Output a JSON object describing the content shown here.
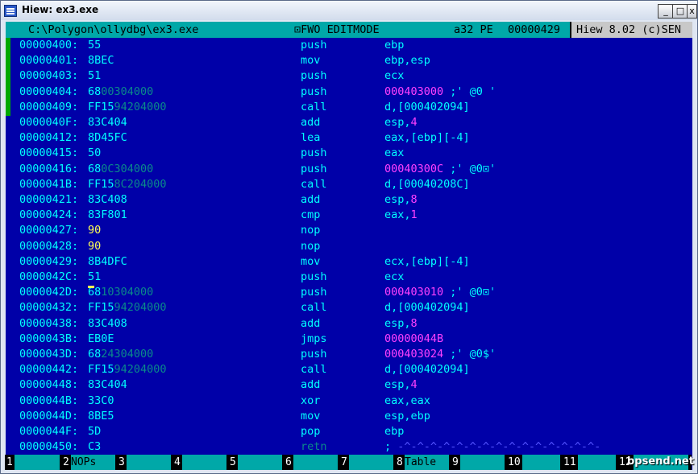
{
  "window": {
    "title": "Hiew: ex3.exe",
    "min_glyph": "_",
    "max_glyph": "□",
    "close_glyph": "x",
    "icon": "app-grid-icon"
  },
  "header": {
    "path": "C:\\Polygon\\ollydbg\\ex3.exe",
    "mode": "⊡FWO EDITMODE",
    "arch": "a32 PE",
    "offset": "00000429",
    "brand": "Hiew 8.02 (c)SEN"
  },
  "colors": {
    "background": "#0000a8",
    "header": "#00a8a8",
    "text": "#00ffff",
    "immediate": "#ff40ff",
    "edited": "#ffff55",
    "fixup": "#0a8a8a"
  },
  "rows": [
    {
      "addr": "00000400:",
      "hex": [
        [
          "55",
          "c"
        ]
      ],
      "mn": "push",
      "op": [
        [
          "ebp",
          "c"
        ]
      ]
    },
    {
      "addr": "00000401:",
      "hex": [
        [
          "8BEC",
          "c"
        ]
      ],
      "mn": "mov",
      "op": [
        [
          "ebp,esp",
          "c"
        ]
      ]
    },
    {
      "addr": "00000403:",
      "hex": [
        [
          "51",
          "c"
        ]
      ],
      "mn": "push",
      "op": [
        [
          "ecx",
          "c"
        ]
      ]
    },
    {
      "addr": "00000404:",
      "hex": [
        [
          "68",
          "c"
        ],
        [
          "00304000",
          "d"
        ]
      ],
      "mn": "push",
      "op": [
        [
          "000403000",
          "m"
        ],
        [
          " ;' @0 '",
          "c"
        ]
      ]
    },
    {
      "addr": "00000409:",
      "hex": [
        [
          "FF15",
          "c"
        ],
        [
          "94204000",
          "d"
        ]
      ],
      "mn": "call",
      "op": [
        [
          "d,[000402094]",
          "c"
        ]
      ]
    },
    {
      "addr": "0000040F:",
      "hex": [
        [
          "83C404",
          "c"
        ]
      ],
      "mn": "add",
      "op": [
        [
          "esp,",
          "c"
        ],
        [
          "4",
          "m"
        ]
      ]
    },
    {
      "addr": "00000412:",
      "hex": [
        [
          "8D45FC",
          "c"
        ]
      ],
      "mn": "lea",
      "op": [
        [
          "eax,[ebp][-4]",
          "c"
        ]
      ]
    },
    {
      "addr": "00000415:",
      "hex": [
        [
          "50",
          "c"
        ]
      ],
      "mn": "push",
      "op": [
        [
          "eax",
          "c"
        ]
      ]
    },
    {
      "addr": "00000416:",
      "hex": [
        [
          "68",
          "c"
        ],
        [
          "0C304000",
          "d"
        ]
      ],
      "mn": "push",
      "op": [
        [
          "00040300C",
          "m"
        ],
        [
          " ;' @0⊡'",
          "c"
        ]
      ]
    },
    {
      "addr": "0000041B:",
      "hex": [
        [
          "FF15",
          "c"
        ],
        [
          "8C204000",
          "d"
        ]
      ],
      "mn": "call",
      "op": [
        [
          "d,[00040208C]",
          "c"
        ]
      ]
    },
    {
      "addr": "00000421:",
      "hex": [
        [
          "83C408",
          "c"
        ]
      ],
      "mn": "add",
      "op": [
        [
          "esp,",
          "c"
        ],
        [
          "8",
          "m"
        ]
      ]
    },
    {
      "addr": "00000424:",
      "hex": [
        [
          "83F801",
          "c"
        ]
      ],
      "mn": "cmp",
      "op": [
        [
          "eax,",
          "c"
        ],
        [
          "1",
          "m"
        ]
      ]
    },
    {
      "addr": "00000427:",
      "hex": [
        [
          "90",
          "y"
        ]
      ],
      "mn": "nop",
      "op": []
    },
    {
      "addr": "00000428:",
      "hex": [
        [
          "90",
          "y"
        ]
      ],
      "mn": "nop",
      "op": []
    },
    {
      "addr": "00000429:",
      "hex": [
        [
          "8B4DFC",
          "c"
        ]
      ],
      "mn": "mov",
      "op": [
        [
          "ecx,[ebp][-4]",
          "c"
        ]
      ]
    },
    {
      "addr": "0000042C:",
      "hex": [
        [
          "51",
          "c"
        ]
      ],
      "mn": "push",
      "op": [
        [
          "ecx",
          "c"
        ]
      ]
    },
    {
      "addr": "0000042D:",
      "hex": [
        [
          "68",
          "c"
        ],
        [
          "10304000",
          "d"
        ]
      ],
      "mn": "push",
      "op": [
        [
          "000403010",
          "m"
        ],
        [
          " ;' @0⊡'",
          "c"
        ]
      ]
    },
    {
      "addr": "00000432:",
      "hex": [
        [
          "FF15",
          "c"
        ],
        [
          "94204000",
          "d"
        ]
      ],
      "mn": "call",
      "op": [
        [
          "d,[000402094]",
          "c"
        ]
      ]
    },
    {
      "addr": "00000438:",
      "hex": [
        [
          "83C408",
          "c"
        ]
      ],
      "mn": "add",
      "op": [
        [
          "esp,",
          "c"
        ],
        [
          "8",
          "m"
        ]
      ]
    },
    {
      "addr": "0000043B:",
      "hex": [
        [
          "EB0E",
          "c"
        ]
      ],
      "mn": "jmps",
      "op": [
        [
          "00000044B",
          "m"
        ]
      ]
    },
    {
      "addr": "0000043D:",
      "hex": [
        [
          "68",
          "c"
        ],
        [
          "24304000",
          "d"
        ]
      ],
      "mn": "push",
      "op": [
        [
          "000403024",
          "m"
        ],
        [
          " ;' @0$'",
          "c"
        ]
      ]
    },
    {
      "addr": "00000442:",
      "hex": [
        [
          "FF15",
          "c"
        ],
        [
          "94204000",
          "d"
        ]
      ],
      "mn": "call",
      "op": [
        [
          "d,[000402094]",
          "c"
        ]
      ]
    },
    {
      "addr": "00000448:",
      "hex": [
        [
          "83C404",
          "c"
        ]
      ],
      "mn": "add",
      "op": [
        [
          "esp,",
          "c"
        ],
        [
          "4",
          "m"
        ]
      ]
    },
    {
      "addr": "0000044B:",
      "hex": [
        [
          "33C0",
          "c"
        ]
      ],
      "mn": "xor",
      "op": [
        [
          "eax,eax",
          "c"
        ]
      ]
    },
    {
      "addr": "0000044D:",
      "hex": [
        [
          "8BE5",
          "c"
        ]
      ],
      "mn": "mov",
      "op": [
        [
          "esp,ebp",
          "c"
        ]
      ]
    },
    {
      "addr": "0000044F:",
      "hex": [
        [
          "5D",
          "c"
        ]
      ],
      "mn": "pop",
      "op": [
        [
          "ebp",
          "c"
        ]
      ]
    },
    {
      "addr": "00000450:",
      "hex": [
        [
          "C3",
          "c"
        ]
      ],
      "mn": "retn",
      "mn_color": "d",
      "op": [
        [
          "; ",
          "c"
        ],
        [
          "-^-^-^-^-^-^-^-^-^-^-^-^-^-^-^-",
          "b"
        ]
      ]
    }
  ],
  "fkeys": [
    {
      "num": "1",
      "label": ""
    },
    {
      "num": "2",
      "label": "NOPs"
    },
    {
      "num": "3",
      "label": ""
    },
    {
      "num": "4",
      "label": ""
    },
    {
      "num": "5",
      "label": ""
    },
    {
      "num": "6",
      "label": ""
    },
    {
      "num": "7",
      "label": ""
    },
    {
      "num": "8",
      "label": "Table"
    },
    {
      "num": "9",
      "label": ""
    },
    {
      "num": "10",
      "label": ""
    },
    {
      "num": "11",
      "label": ""
    },
    {
      "num": "12",
      "label": ""
    }
  ],
  "watermark": "bpsend.net"
}
